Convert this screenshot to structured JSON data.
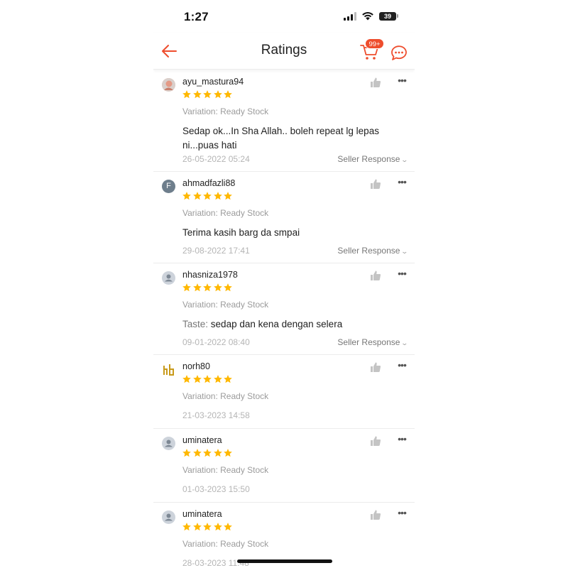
{
  "status_bar": {
    "time": "1:27",
    "battery": "39"
  },
  "header": {
    "title": "Ratings",
    "cart_badge": "99+",
    "back_icon": "arrow-left-icon",
    "cart_icon": "shopping-cart-icon",
    "chat_icon": "chat-bubble-icon"
  },
  "colors": {
    "accent": "#ee4d2d",
    "star": "#ffb800"
  },
  "reviews": [
    {
      "username": "ayu_mastura94",
      "avatar_type": "photo",
      "stars": 5,
      "variation": "Variation: Ready Stock",
      "comment": "Sedap ok...In Sha Allah.. boleh repeat lg lepas ni...puas hati",
      "date": "26-05-2022 05:24",
      "seller_response": "Seller Response"
    },
    {
      "username": "ahmadfazli88",
      "avatar_type": "letter",
      "avatar_letter": "F",
      "stars": 5,
      "variation": "Variation: Ready Stock",
      "comment": "Terima kasih barg da smpai",
      "date": "29-08-2022 17:41",
      "seller_response": "Seller Response"
    },
    {
      "username": "nhasniza1978",
      "avatar_type": "default",
      "stars": 5,
      "variation": "Variation: Ready Stock",
      "comment_label": "Taste:",
      "comment": "sedap dan kena dengan selera",
      "date": "09-01-2022 08:40",
      "seller_response": "Seller Response"
    },
    {
      "username": "norh80",
      "avatar_type": "logo",
      "stars": 5,
      "variation": "Variation: Ready Stock",
      "date": "21-03-2023 14:58"
    },
    {
      "username": "uminatera",
      "avatar_type": "default",
      "stars": 5,
      "variation": "Variation: Ready Stock",
      "date": "01-03-2023 15:50"
    },
    {
      "username": "uminatera",
      "avatar_type": "default",
      "stars": 5,
      "variation": "Variation: Ready Stock",
      "date": "28-03-2023 11:48"
    }
  ]
}
